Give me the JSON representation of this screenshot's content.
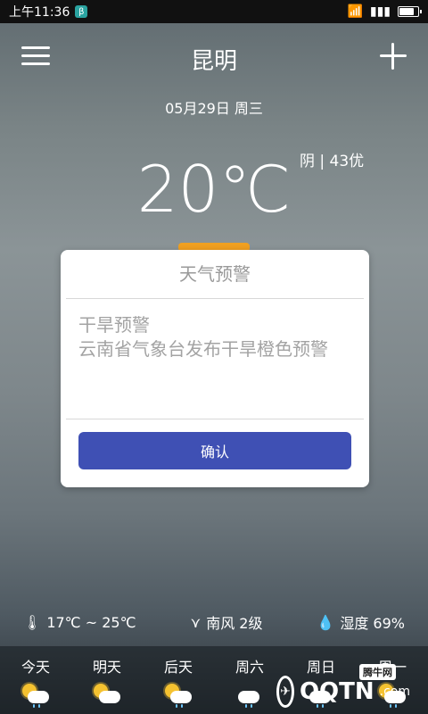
{
  "status": {
    "time": "上午11:36",
    "app_badge": "β"
  },
  "header": {
    "city": "昆明"
  },
  "date": "05月29日 周三",
  "current": {
    "temperature": "20℃",
    "aqi": "阴 | 43优"
  },
  "dialog": {
    "title": "天气预警",
    "headline": "干旱预警",
    "message": "云南省气象台发布干旱橙色预警",
    "confirm": "确认"
  },
  "stats": {
    "temp_range": "17℃ ~ 25℃",
    "wind": "南风 2级",
    "humidity": "湿度 69%"
  },
  "forecast": [
    {
      "label": "今天",
      "icon": "sun-cloud-rain-icon"
    },
    {
      "label": "明天",
      "icon": "sun-cloud-icon"
    },
    {
      "label": "后天",
      "icon": "sun-cloud-rain-icon"
    },
    {
      "label": "周六",
      "icon": "cloud-rain-icon"
    },
    {
      "label": "周日",
      "icon": "cloud-rain-icon"
    },
    {
      "label": "周一",
      "icon": "sun-cloud-rain-icon"
    }
  ],
  "watermark": {
    "text": "QQTN",
    "badge": "腾牛网",
    "suffix": ".com"
  },
  "colors": {
    "accent": "#3f50b4",
    "tab": "#f1a020"
  }
}
